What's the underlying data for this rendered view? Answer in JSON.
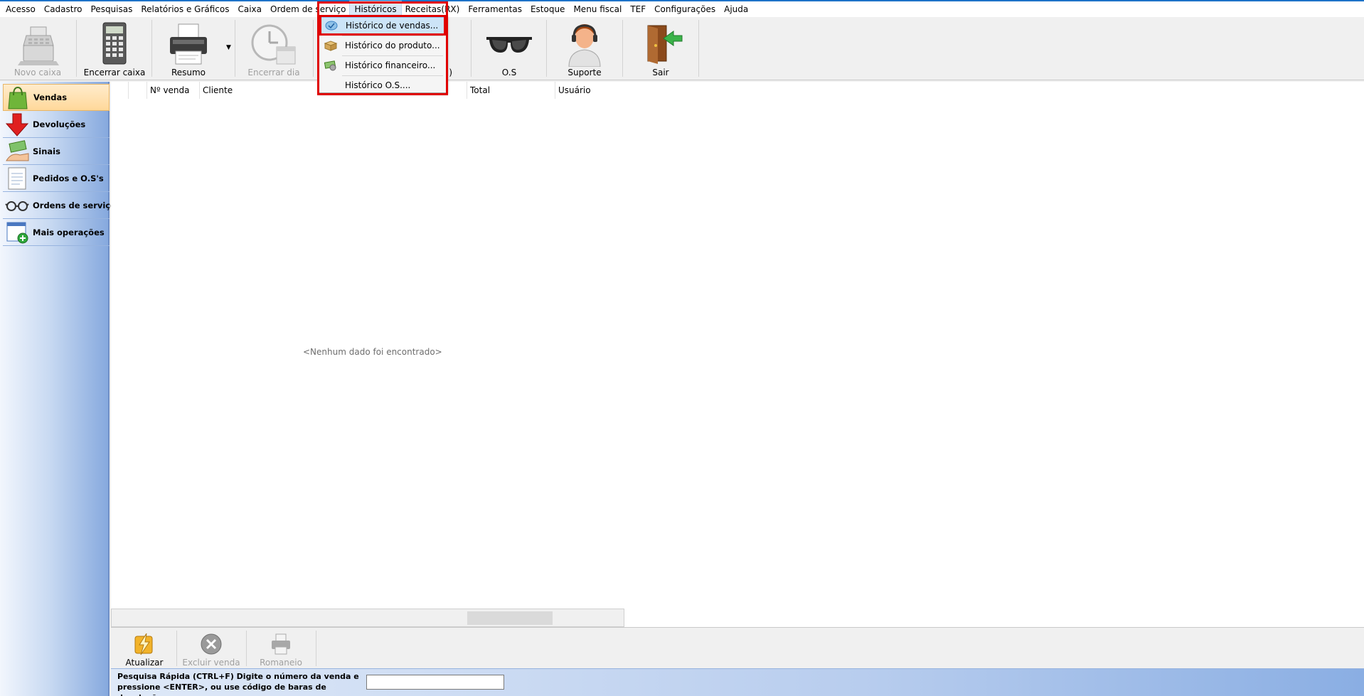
{
  "menubar": {
    "items": [
      "Acesso",
      "Cadastro",
      "Pesquisas",
      "Relatórios e Gráficos",
      "Caixa",
      "Ordem de serviço",
      "Históricos",
      "Receitas(RX)",
      "Ferramentas",
      "Estoque",
      "Menu fiscal",
      "TEF",
      "Configurações",
      "Ajuda"
    ],
    "active": "Históricos"
  },
  "toolbar": {
    "novo_caixa": "Novo caixa",
    "encerrar_caixa": "Encerrar caixa",
    "resumo": "Resumo",
    "encerrar_dia": "Encerrar dia",
    "partial_label": ")",
    "os": "O.S",
    "suporte": "Suporte",
    "sair": "Sair"
  },
  "sidebar": {
    "items": [
      {
        "label": "Vendas",
        "icon": "shopping-bag-icon",
        "selected": true
      },
      {
        "label": "Devoluções",
        "icon": "arrow-down-icon"
      },
      {
        "label": "Sinais",
        "icon": "money-hand-icon"
      },
      {
        "label": "Pedidos e O.S's",
        "icon": "document-icon"
      },
      {
        "label": "Ordens de serviço",
        "icon": "glasses-icon"
      },
      {
        "label": "Mais operações",
        "icon": "window-plus-icon"
      }
    ]
  },
  "grid": {
    "columns": [
      "Nº venda",
      "Cliente",
      "Total",
      "Usuário"
    ],
    "empty_text": "<Nenhum dado foi encontrado>"
  },
  "bottombar": {
    "atualizar": "Atualizar",
    "excluir_venda": "Excluir venda",
    "romaneio": "Romaneio"
  },
  "quick_search": {
    "label": "Pesquisa Rápida (CTRL+F) Digite o número da venda e pressione <ENTER>, ou use código de baras de devolução",
    "value": ""
  },
  "dropdown": {
    "items": [
      "Histórico de vendas...",
      "Histórico do produto...",
      "Histórico financeiro...",
      "Histórico O.S...."
    ],
    "highlighted": 0
  },
  "colors": {
    "highlight_border": "#e00000",
    "menu_highlight": "#cce4f7",
    "sidebar_selected": "#ffd89a"
  }
}
